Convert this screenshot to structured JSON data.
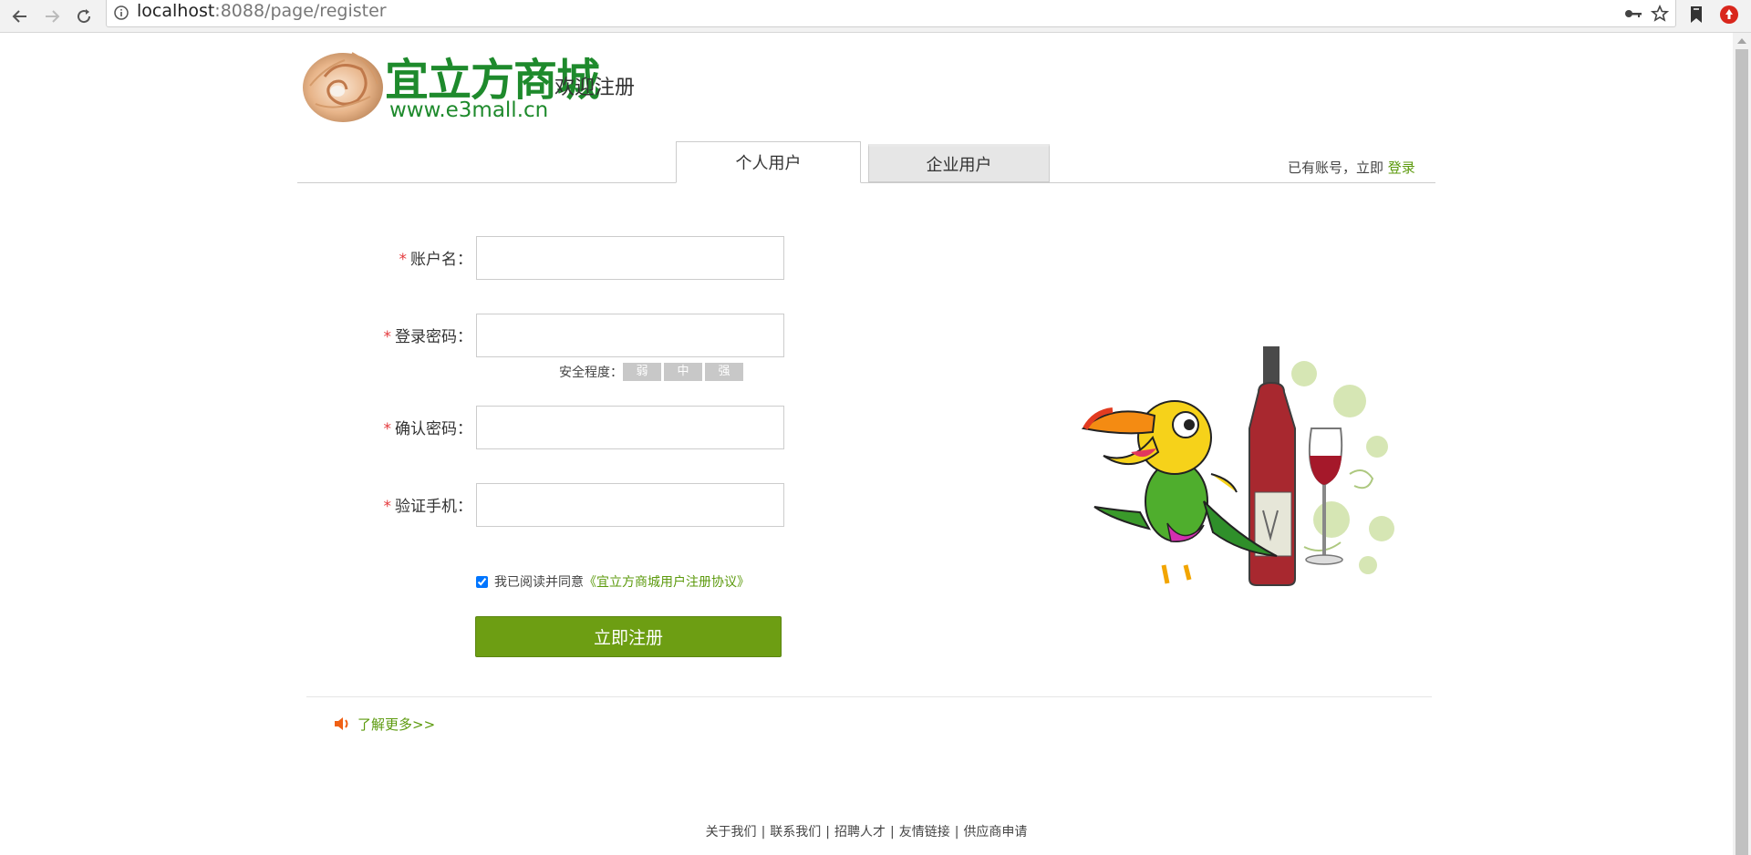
{
  "browser": {
    "url_host": "localhost",
    "url_rest": ":8088/page/register"
  },
  "header": {
    "logo_text": "宜立方商城",
    "logo_url": "www.e3mall.cn",
    "welcome": "欢迎注册"
  },
  "tabs": {
    "personal": "个人用户",
    "company": "企业用户"
  },
  "account": {
    "prefix": "已有账号，立即",
    "login_link": "登录"
  },
  "form": {
    "required_mark": "*",
    "username_label": "账户名：",
    "password_label": "登录密码：",
    "confirm_label": "确认密码：",
    "phone_label": "验证手机：",
    "username_value": "",
    "password_value": "",
    "confirm_value": "",
    "phone_value": "",
    "strength_label": "安全程度：",
    "strength_levels": [
      "弱",
      "中",
      "强"
    ],
    "agree_checked": true,
    "agree_text": "我已阅读并同意",
    "agreement_link": "《宜立方商城用户注册协议》",
    "submit": "立即注册"
  },
  "learn_more": "了解更多>>",
  "footer": {
    "links": [
      "关于我们",
      "联系我们",
      "招聘人才",
      "友情链接",
      "供应商申请"
    ],
    "separator": "|"
  },
  "colors": {
    "brand_green": "#6d9e13",
    "link_green": "#5c9a0d",
    "required_red": "#e4393c"
  }
}
